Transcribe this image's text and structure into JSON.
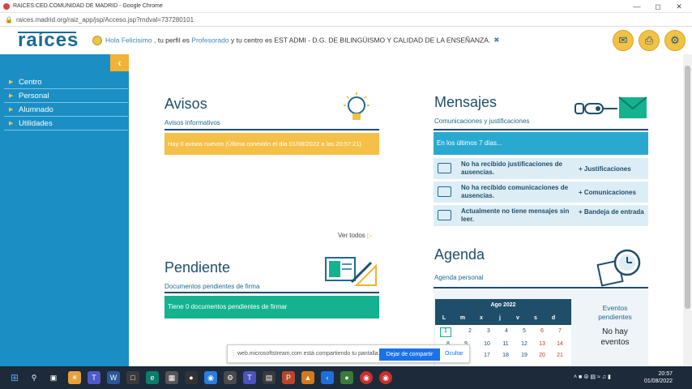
{
  "window": {
    "title": "RAICES:CED.COMUNIDAD DE MADRID - Google Chrome"
  },
  "browser": {
    "url": "raices.madrid.org/raiz_app/jsp/Acceso.jsp?rndval=737280101"
  },
  "header": {
    "logo": "raíces",
    "greeting_hello": "Hola Felicisimo",
    "greeting_mid": " , tu perfil es ",
    "greeting_profile": "Profesorado",
    "greeting_center": " y tu centro es EST ADMI - D.G. DE BILINGÜISMO Y CALIDAD DE LA ENSEÑANZA."
  },
  "sidebar": {
    "items": [
      {
        "label": "Centro"
      },
      {
        "label": "Personal"
      },
      {
        "label": "Alumnado"
      },
      {
        "label": "Utilidades"
      }
    ]
  },
  "avisos": {
    "title": "Avisos",
    "subtitle": "Avisos informativos",
    "banner": "Hay 0 avisos nuevos (Última conexión el día 01/08/2022 a las 20:57:21)",
    "see_all": "Ver todos"
  },
  "mensajes": {
    "title": "Mensajes",
    "subtitle": "Comunicaciones y justificaciones",
    "banner": "En los últimos 7 días...",
    "rows": [
      {
        "text": "No ha recibido justificaciones de ausencias.",
        "link": "+ Justificaciones"
      },
      {
        "text": "No ha recibido comunicaciones de ausencias.",
        "link": "+ Comunicaciones"
      },
      {
        "text": "Actualmente no tiene mensajes sin leer.",
        "link": "+ Bandeja de entrada"
      }
    ]
  },
  "pendiente": {
    "title": "Pendiente",
    "subtitle": "Documentos pendientes de firma",
    "banner": "Tiene 0 documentos pendientes de firmar"
  },
  "agenda": {
    "title": "Agenda",
    "subtitle": "Agenda personal",
    "month": "Ago 2022",
    "weekdays": [
      "L",
      "m",
      "x",
      "j",
      "v",
      "s",
      "d"
    ],
    "week1": [
      "1",
      "2",
      "3",
      "4",
      "5",
      "6",
      "7"
    ],
    "week2": [
      "8",
      "9",
      "10",
      "11",
      "12",
      "13",
      "14"
    ],
    "week3": [
      "15",
      "16",
      "17",
      "18",
      "19",
      "20",
      "21"
    ],
    "events_title": "Eventos pendientes",
    "events_none": "No hay eventos"
  },
  "share_bar": {
    "text": "web.microsoftstream.com está compartiendo tu pantalla.",
    "stop": "Dejar de compartir",
    "hide": "Ocultar"
  },
  "taskbar": {
    "time": "20:57",
    "date": "01/08/2022"
  },
  "colors": {
    "sidebar": "#1b8fc4",
    "accent_yellow": "#f2c146",
    "teal": "#14b28f",
    "navy": "#1f4e6b"
  }
}
